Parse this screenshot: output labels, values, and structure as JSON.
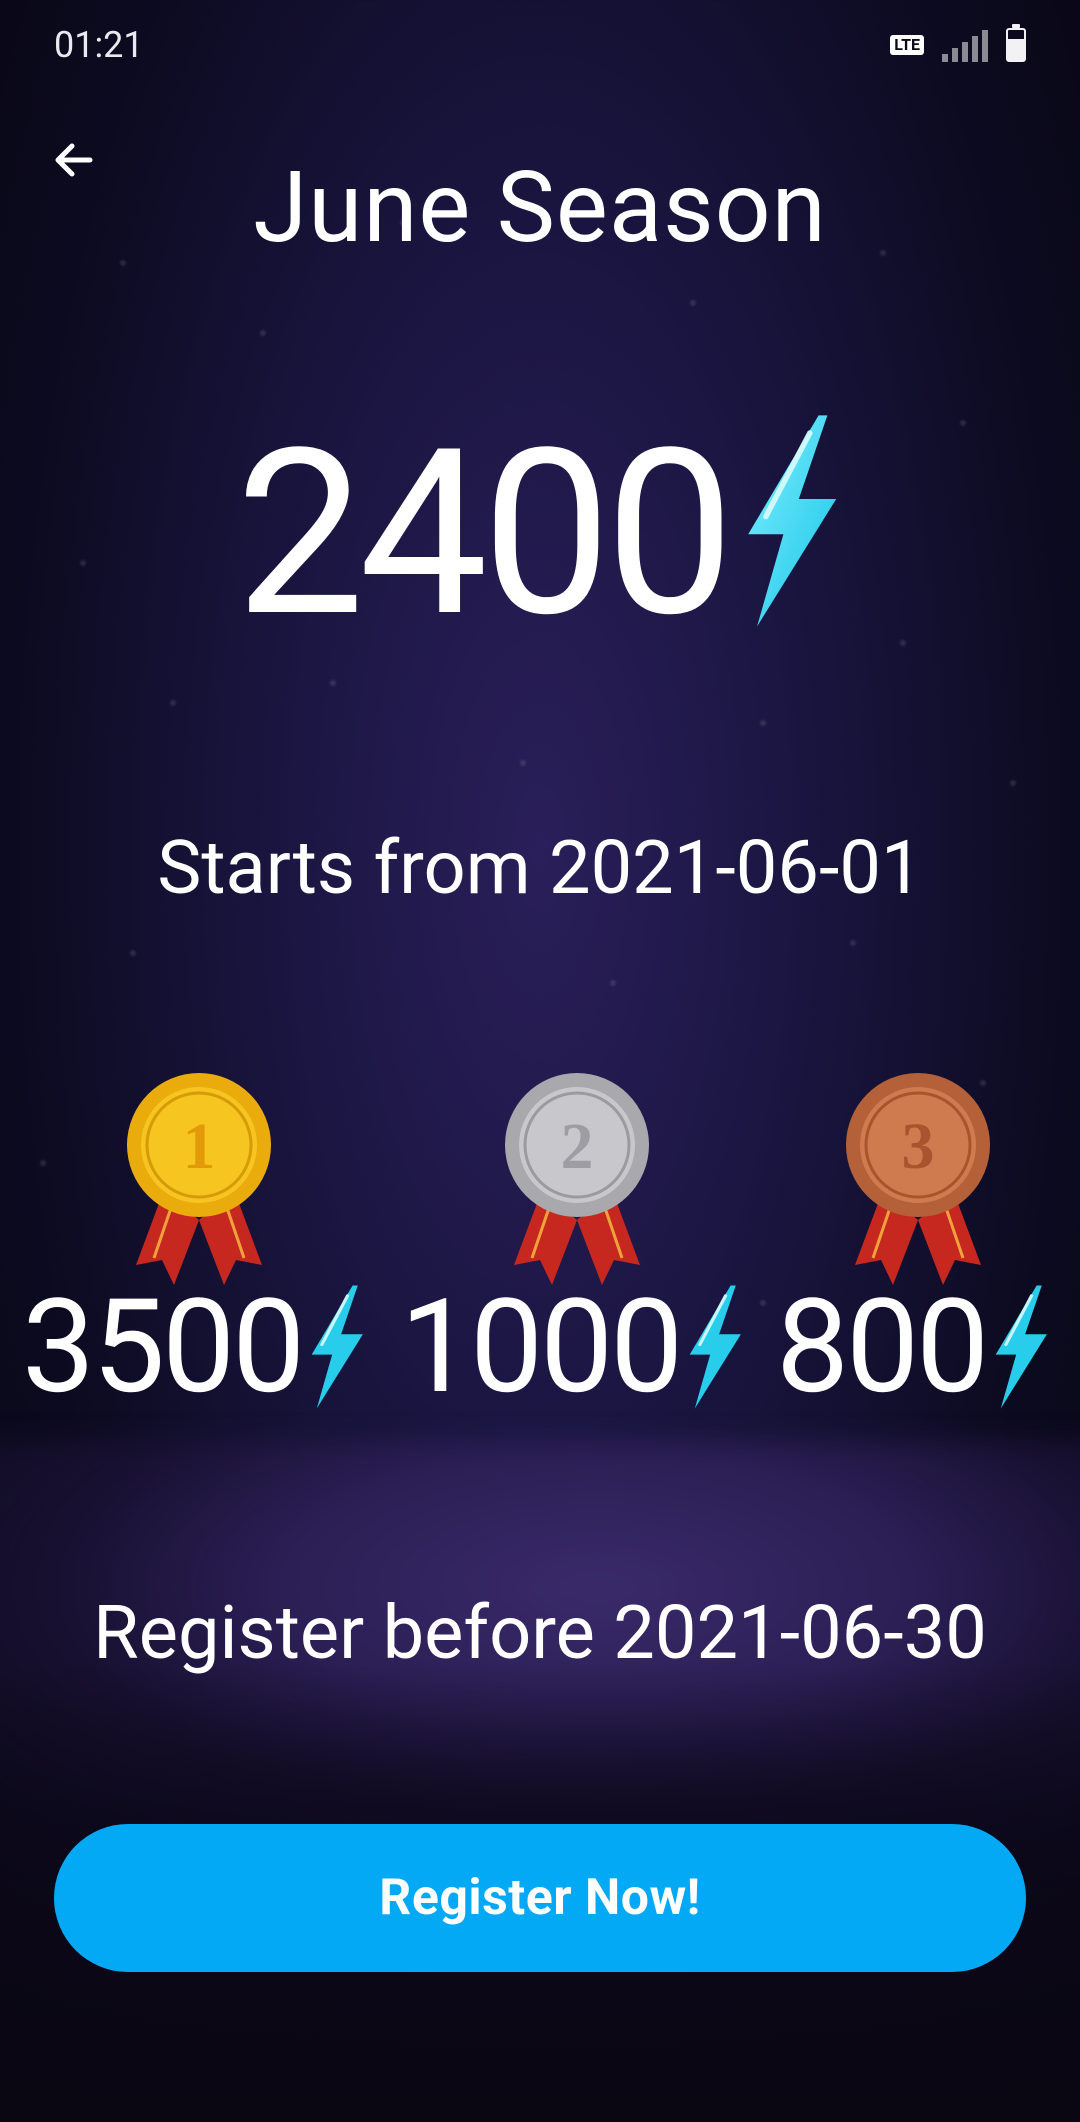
{
  "status_bar": {
    "time": "01:21",
    "network": "LTE"
  },
  "header": {
    "back_icon": "arrow-back-icon",
    "title": "June Season"
  },
  "points": {
    "value": "2400",
    "icon": "lightning-bolt-icon",
    "bolt_color": "#38d6f0"
  },
  "season": {
    "starts_text": "Starts from 2021-06-01",
    "register_before_text": "Register before 2021-06-30"
  },
  "prizes": [
    {
      "rank": "1",
      "medal": "gold-medal-icon",
      "amount": "3500"
    },
    {
      "rank": "2",
      "medal": "silver-medal-icon",
      "amount": "1000"
    },
    {
      "rank": "3",
      "medal": "bronze-medal-icon",
      "amount": "800"
    }
  ],
  "cta": {
    "label": "Register Now!",
    "color": "#03a9f4"
  }
}
